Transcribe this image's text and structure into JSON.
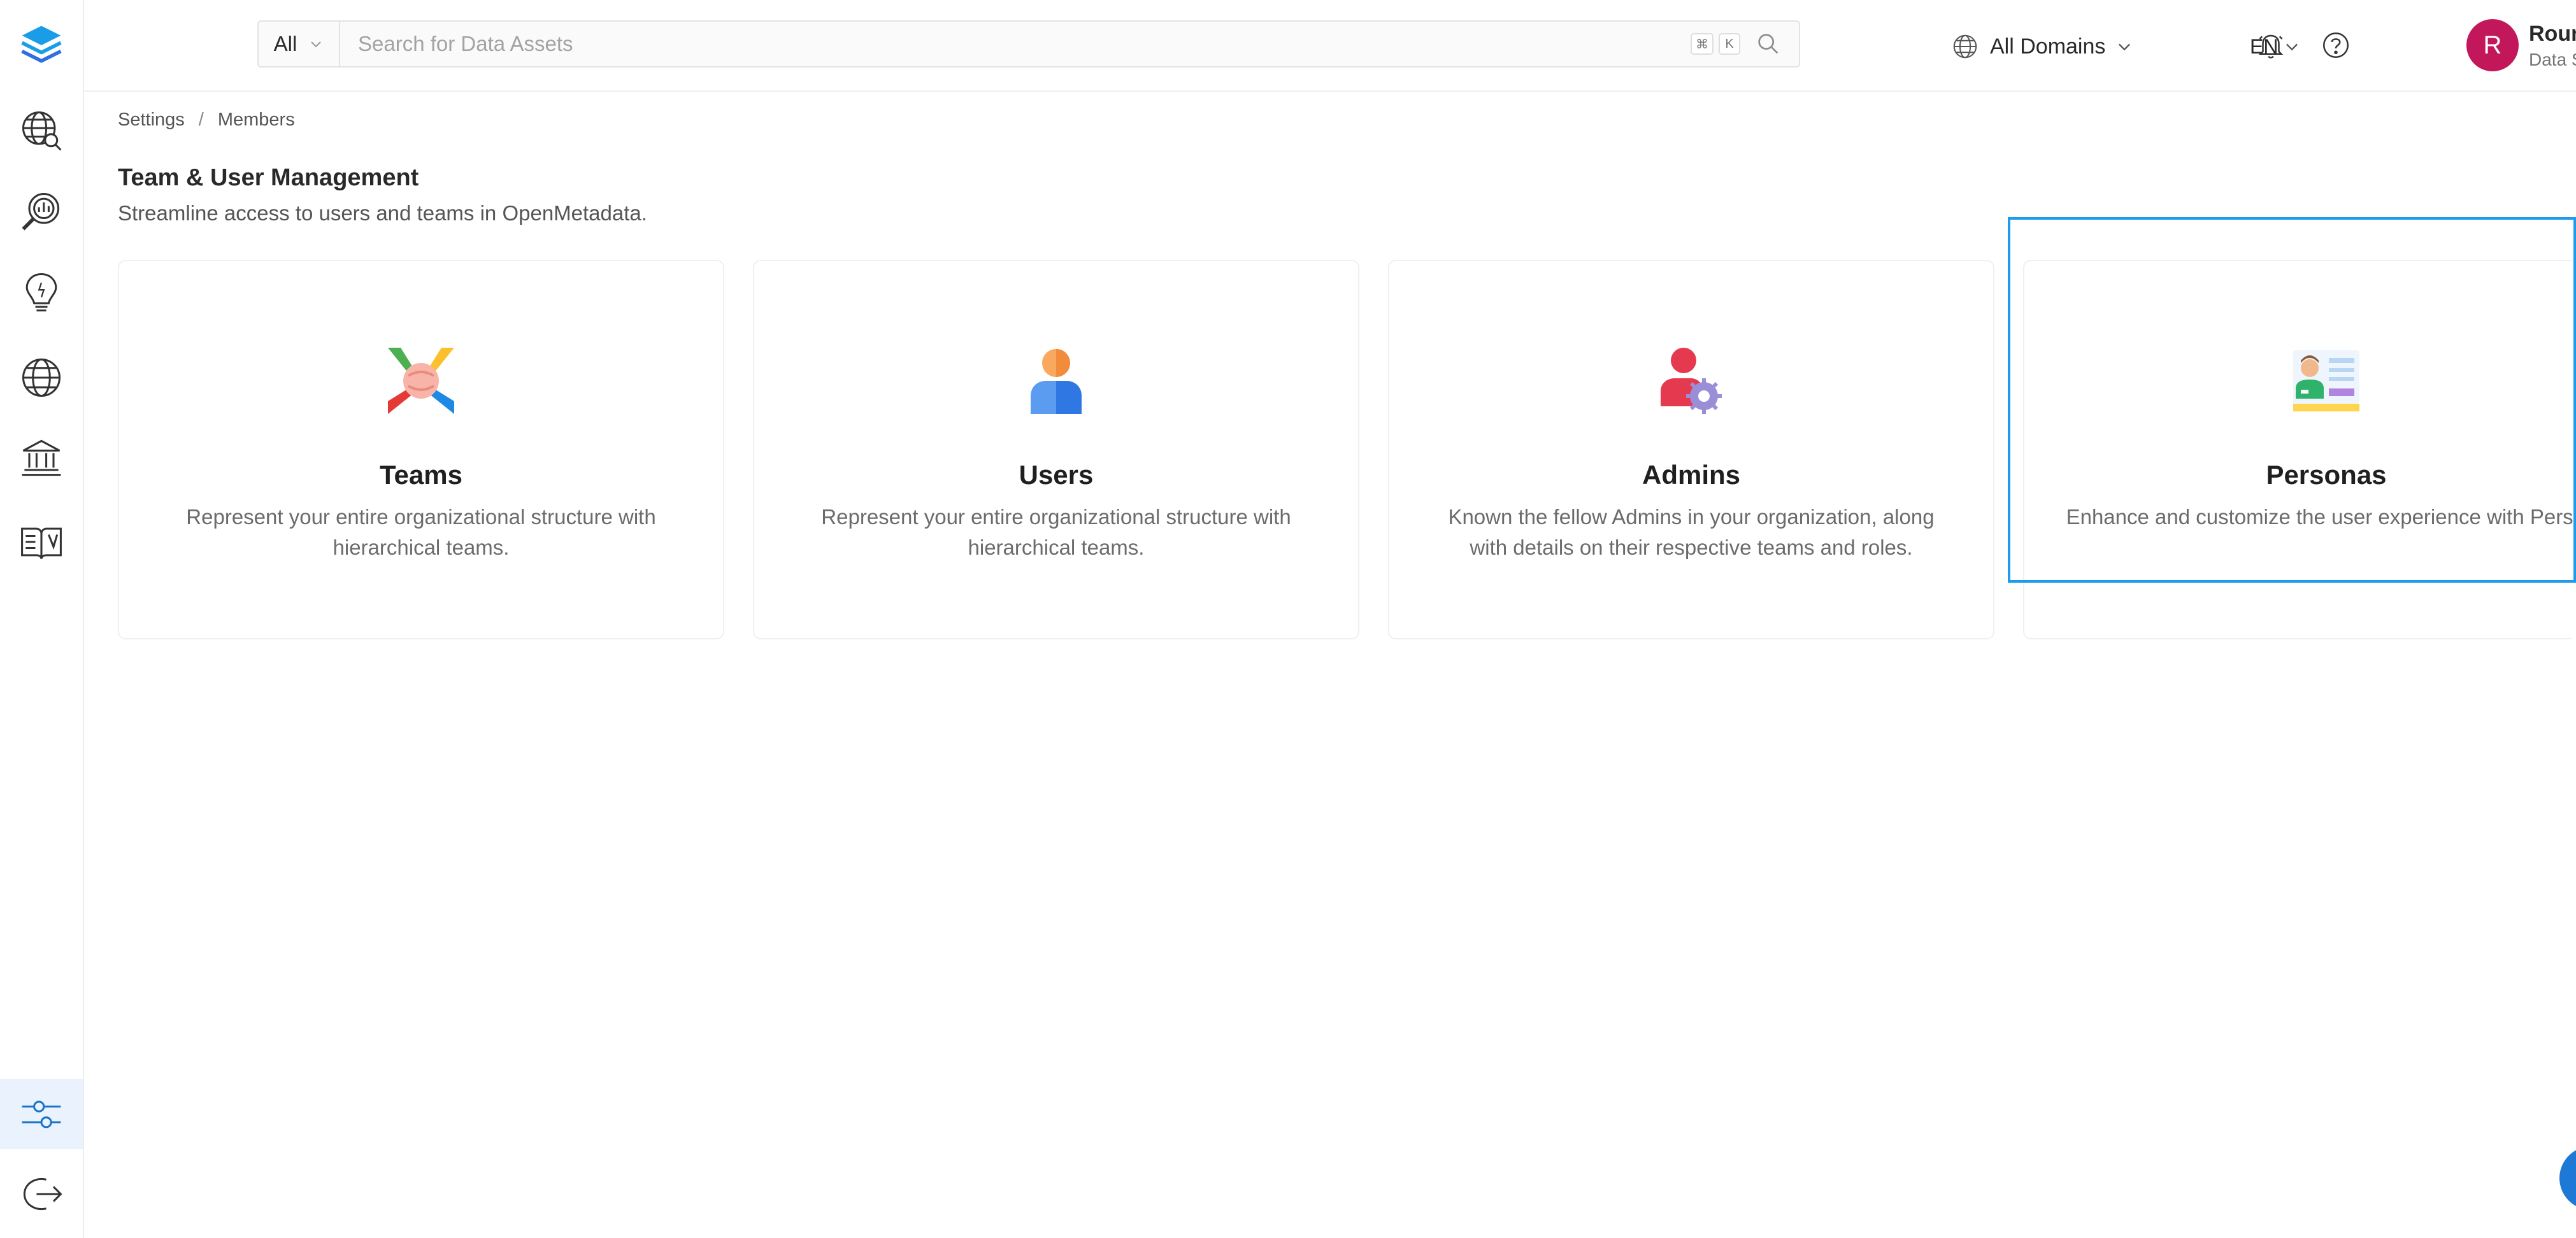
{
  "sidebar": {
    "items": [
      {
        "icon": "layers-logo-icon"
      },
      {
        "icon": "globe-search-icon"
      },
      {
        "icon": "data-insights-icon"
      },
      {
        "icon": "lightbulb-icon"
      },
      {
        "icon": "globe-icon"
      },
      {
        "icon": "governance-bank-icon"
      },
      {
        "icon": "knowledge-book-icon"
      },
      {
        "icon": "settings-sliders-icon"
      },
      {
        "icon": "logout-icon"
      }
    ],
    "active_item": "settings-sliders-icon"
  },
  "header": {
    "search": {
      "scope_label": "All",
      "placeholder": "Search for Data Assets",
      "shortcut_keys": [
        "⌘",
        "K"
      ]
    },
    "domains_label": "All Domains",
    "language_label": "EN",
    "user": {
      "avatar_initial": "R",
      "name": "Rounakpreet.",
      "role": "Data Steward"
    }
  },
  "breadcrumb": {
    "items": [
      "Settings",
      "Members"
    ],
    "separator": "/"
  },
  "page": {
    "title": "Team & User Management",
    "subtitle": "Streamline access to users and teams in OpenMetadata."
  },
  "cards": [
    {
      "title": "Teams",
      "description": "Represent your entire organizational structure with hierarchical teams.",
      "icon": "teams-handshake-icon"
    },
    {
      "title": "Users",
      "description": "Represent your entire organizational structure with hierarchical teams.",
      "icon": "user-icon"
    },
    {
      "title": "Admins",
      "description": "Known the fellow Admins in your organization, along with details on their respective teams and roles.",
      "icon": "admin-gear-icon"
    },
    {
      "title": "Personas",
      "description": "Enhance and customize the user experience with Personas.",
      "icon": "persona-card-icon"
    }
  ],
  "colors": {
    "accent": "#1e9bea",
    "avatar": "#c2185b",
    "sidebar_active": "#eaf3fd"
  }
}
